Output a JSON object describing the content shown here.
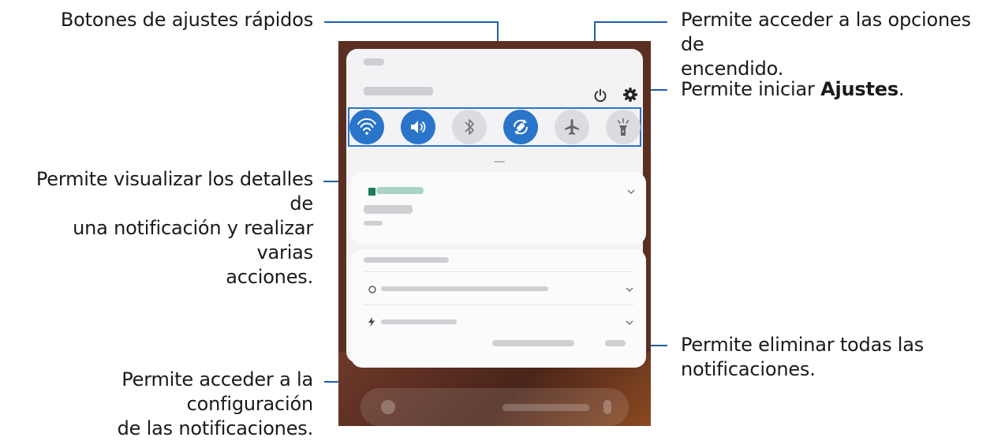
{
  "callouts": {
    "quick_settings": "Botones de ajustes rápidos",
    "power_line1": "Permite acceder a las opciones de",
    "power_line2": "encendido.",
    "settings_prefix": "Permite iniciar ",
    "settings_bold": "Ajustes",
    "settings_suffix": ".",
    "details_line1": "Permite visualizar los detalles de",
    "details_line2": "una notificación y realizar varias",
    "details_line3": "acciones.",
    "clear_line1": "Permite eliminar todas las",
    "clear_line2": "notificaciones.",
    "notif_settings_line1": "Permite acceder a la configuración",
    "notif_settings_line2": "de las notificaciones."
  },
  "quick_settings_buttons": [
    {
      "icon": "wifi-icon",
      "state": "on"
    },
    {
      "icon": "sound-icon",
      "state": "on"
    },
    {
      "icon": "bluetooth-icon",
      "state": "off"
    },
    {
      "icon": "auto-rotate-icon",
      "state": "on"
    },
    {
      "icon": "airplane-mode-icon",
      "state": "off"
    },
    {
      "icon": "flashlight-icon",
      "state": "off"
    }
  ],
  "colors": {
    "accent": "#2a74c9",
    "callout_line": "#1f5fa8",
    "panel": "#f3f3f5",
    "inactive_button": "#dcdce0",
    "wallpaper": "#5a2f22"
  }
}
